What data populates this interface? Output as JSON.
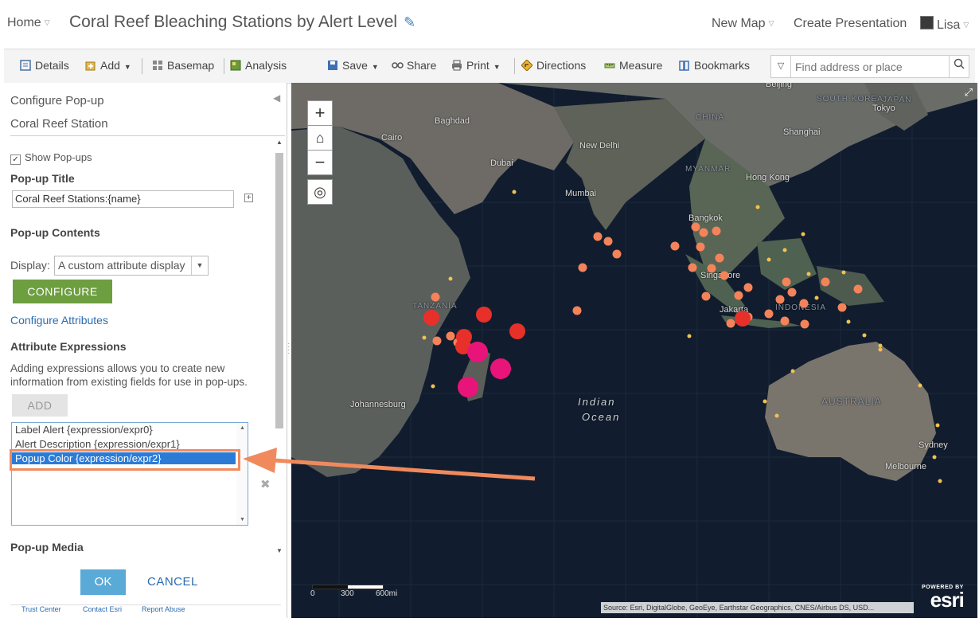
{
  "header": {
    "home_label": "Home",
    "map_title": "Coral Reef Bleaching Stations by Alert Level",
    "new_map_label": "New Map",
    "create_presentation_label": "Create Presentation",
    "user_name": "Lisa"
  },
  "toolbar": {
    "details": "Details",
    "add": "Add",
    "basemap": "Basemap",
    "analysis": "Analysis",
    "save": "Save",
    "share": "Share",
    "print": "Print",
    "directions": "Directions",
    "measure": "Measure",
    "bookmarks": "Bookmarks",
    "search_placeholder": "Find address or place"
  },
  "panel": {
    "title": "Configure Pop-up",
    "layer_name": "Coral Reef Station",
    "show_popups_label": "Show Pop-ups",
    "show_popups_checked": true,
    "popup_title_heading": "Pop-up Title",
    "popup_title_value": "Coral Reef Stations:{name}",
    "popup_contents_heading": "Pop-up Contents",
    "display_label": "Display:",
    "display_value": "A custom attribute display",
    "configure_button": "CONFIGURE",
    "configure_attributes_link": "Configure Attributes",
    "attribute_expressions_heading": "Attribute Expressions",
    "attribute_expressions_desc": "Adding expressions allows you to create new information from existing fields for use in pop-ups.",
    "add_button": "ADD",
    "expressions": [
      "Label Alert {expression/expr0}",
      "Alert Description {expression/expr1}",
      "Popup Color {expression/expr2}"
    ],
    "selected_expression": "Popup Color {expression/expr2}",
    "popup_media_heading": "Pop-up Media",
    "ok_button": "OK",
    "cancel_button": "CANCEL",
    "footer_links": [
      "Trust Center",
      "Contact Esri",
      "Report Abuse"
    ]
  },
  "map": {
    "labels": {
      "baghdad": "Baghdad",
      "cairo": "Cairo",
      "dubai": "Dubai",
      "new_delhi": "New Delhi",
      "mumbai": "Mumbai",
      "china": "CHINA",
      "myanmar": "MYANMAR",
      "shanghai": "Shanghai",
      "hong_kong": "Hong Kong",
      "beijing": "Beijing",
      "south_korea": "SOUTH KOREA",
      "japan": "JAPAN",
      "tokyo": "Tokyo",
      "bangkok": "Bangkok",
      "singapore": "Singapore",
      "jakarta": "Jakarta",
      "indonesia": "INDONESIA",
      "tanzania": "TANZANIA",
      "johannesburg": "Johannesburg",
      "indian_ocean_1": "Indian",
      "indian_ocean_2": "Ocean",
      "australia": "AUSTRALIA",
      "sydney": "Sydney",
      "melbourne": "Melbourne"
    },
    "scale_labels": [
      "0",
      "300",
      "600mi"
    ],
    "attribution": "Source: Esri, DigitalGlobe, GeoEye, Earthstar Geographics, CNES/Airbus DS, USD...",
    "powered_by": "POWERED BY",
    "esri_logo": "esri",
    "zoom_in": "+",
    "zoom_out": "−",
    "alert_colors": {
      "watch": "#f2c14e",
      "warning": "#f5835a",
      "alert1": "#e8302a",
      "alert2": "#e8147a"
    }
  }
}
